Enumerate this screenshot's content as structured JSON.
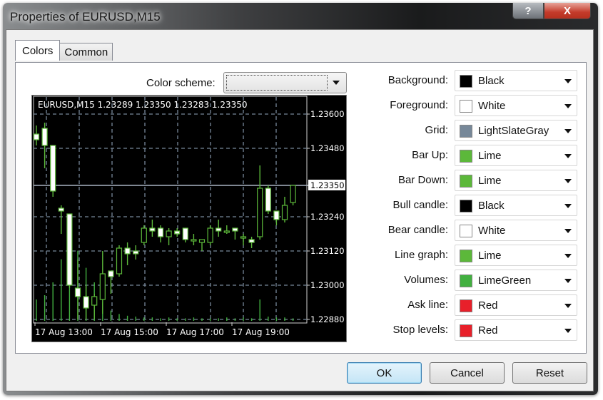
{
  "window": {
    "title": "Properties of EURUSD,M15",
    "help_button": "?",
    "close_button": "X"
  },
  "tabs": [
    {
      "label": "Colors",
      "active": true
    },
    {
      "label": "Common",
      "active": false
    }
  ],
  "color_scheme": {
    "label": "Color scheme:",
    "value": ""
  },
  "properties": [
    {
      "label": "Background:",
      "value": "Black",
      "color": "#000000"
    },
    {
      "label": "Foreground:",
      "value": "White",
      "color": "#ffffff"
    },
    {
      "label": "Grid:",
      "value": "LightSlateGray",
      "color": "#778899"
    },
    {
      "label": "Bar Up:",
      "value": "Lime",
      "color": "#5cb83a"
    },
    {
      "label": "Bar Down:",
      "value": "Lime",
      "color": "#5cb83a"
    },
    {
      "label": "Bull candle:",
      "value": "Black",
      "color": "#000000"
    },
    {
      "label": "Bear candle:",
      "value": "White",
      "color": "#ffffff"
    },
    {
      "label": "Line graph:",
      "value": "Lime",
      "color": "#5cb83a"
    },
    {
      "label": "Volumes:",
      "value": "LimeGreen",
      "color": "#42b040"
    },
    {
      "label": "Ask line:",
      "value": "Red",
      "color": "#e8202a"
    },
    {
      "label": "Stop levels:",
      "value": "Red",
      "color": "#e8202a"
    }
  ],
  "buttons": {
    "ok": "OK",
    "cancel": "Cancel",
    "reset": "Reset"
  },
  "chart_data": {
    "type": "candlestick",
    "title": "EURUSD,M15  1.23289 1.23350 1.23283 1.23350",
    "symbol": "EURUSD,M15",
    "ohlc_header": [
      "1.23289",
      "1.23350",
      "1.23283",
      "1.23350"
    ],
    "current_price": "1.23350",
    "y_ticks": [
      "1.23600",
      "1.23480",
      "1.23350",
      "1.23240",
      "1.23120",
      "1.23000",
      "1.22880"
    ],
    "ylim": [
      1.2288,
      1.2363
    ],
    "x_ticks": [
      "17 Aug 13:00",
      "17 Aug 15:00",
      "17 Aug 17:00",
      "17 Aug 19:00"
    ],
    "grid": true,
    "colors": {
      "background": "#000000",
      "foreground": "#ffffff",
      "grid": "#778899",
      "bar": "#5cb83a",
      "bull_body": "#000000",
      "bear_body": "#ffffff",
      "volumes": "#42b040",
      "bid_line": "#a9b4c2"
    },
    "candles": [
      {
        "o": 1.2353,
        "h": 1.2356,
        "l": 1.2349,
        "c": 1.2351
      },
      {
        "o": 1.2355,
        "h": 1.2357,
        "l": 1.2341,
        "c": 1.2349
      },
      {
        "o": 1.2349,
        "h": 1.2349,
        "l": 1.2331,
        "c": 1.2333
      },
      {
        "o": 1.2327,
        "h": 1.2328,
        "l": 1.2318,
        "c": 1.2326
      },
      {
        "o": 1.2325,
        "h": 1.2325,
        "l": 1.2299,
        "c": 1.23
      },
      {
        "o": 1.2299,
        "h": 1.2309,
        "l": 1.2288,
        "c": 1.2296
      },
      {
        "o": 1.2296,
        "h": 1.23,
        "l": 1.2288,
        "c": 1.2292
      },
      {
        "o": 1.2293,
        "h": 1.2297,
        "l": 1.2288,
        "c": 1.2296
      },
      {
        "o": 1.2295,
        "h": 1.2312,
        "l": 1.229,
        "c": 1.2304
      },
      {
        "o": 1.2305,
        "h": 1.2305,
        "l": 1.2297,
        "c": 1.2303
      },
      {
        "o": 1.2304,
        "h": 1.2314,
        "l": 1.2303,
        "c": 1.2313
      },
      {
        "o": 1.2313,
        "h": 1.2315,
        "l": 1.2307,
        "c": 1.2311
      },
      {
        "o": 1.2312,
        "h": 1.2314,
        "l": 1.2309,
        "c": 1.2311
      },
      {
        "o": 1.2315,
        "h": 1.2321,
        "l": 1.2314,
        "c": 1.232
      },
      {
        "o": 1.232,
        "h": 1.2323,
        "l": 1.2317,
        "c": 1.2319
      },
      {
        "o": 1.232,
        "h": 1.2321,
        "l": 1.2315,
        "c": 1.2317
      },
      {
        "o": 1.2317,
        "h": 1.232,
        "l": 1.2314,
        "c": 1.2319
      },
      {
        "o": 1.2319,
        "h": 1.232,
        "l": 1.2317,
        "c": 1.2318
      },
      {
        "o": 1.232,
        "h": 1.232,
        "l": 1.2315,
        "c": 1.2316
      },
      {
        "o": 1.2316,
        "h": 1.2318,
        "l": 1.2314,
        "c": 1.2316
      },
      {
        "o": 1.2315,
        "h": 1.2316,
        "l": 1.2312,
        "c": 1.2316
      },
      {
        "o": 1.2315,
        "h": 1.2321,
        "l": 1.2314,
        "c": 1.232
      },
      {
        "o": 1.232,
        "h": 1.2323,
        "l": 1.2317,
        "c": 1.2319
      },
      {
        "o": 1.2319,
        "h": 1.2321,
        "l": 1.2318,
        "c": 1.2319
      },
      {
        "o": 1.232,
        "h": 1.232,
        "l": 1.2316,
        "c": 1.2319
      },
      {
        "o": 1.2317,
        "h": 1.2318,
        "l": 1.2314,
        "c": 1.2317
      },
      {
        "o": 1.2316,
        "h": 1.2317,
        "l": 1.2313,
        "c": 1.2315
      },
      {
        "o": 1.2317,
        "h": 1.2342,
        "l": 1.2316,
        "c": 1.2334
      },
      {
        "o": 1.2334,
        "h": 1.2335,
        "l": 1.2325,
        "c": 1.2326
      },
      {
        "o": 1.2326,
        "h": 1.2326,
        "l": 1.2321,
        "c": 1.2323
      },
      {
        "o": 1.2323,
        "h": 1.2331,
        "l": 1.2322,
        "c": 1.2328
      },
      {
        "o": 1.2329,
        "h": 1.2335,
        "l": 1.2328,
        "c": 1.2335
      }
    ],
    "volumes": [
      0.25,
      0.3,
      0.45,
      0.72,
      0.92,
      0.82,
      0.62,
      0.45,
      0.22,
      0.12,
      0.08,
      0.06,
      0.05,
      0.04,
      0.04,
      0.03,
      0.04,
      0.03,
      0.03,
      0.04,
      0.03,
      0.03,
      0.03,
      0.04,
      0.03,
      0.04,
      0.03,
      0.25,
      0.05,
      0.04,
      0.04,
      0.03
    ]
  }
}
